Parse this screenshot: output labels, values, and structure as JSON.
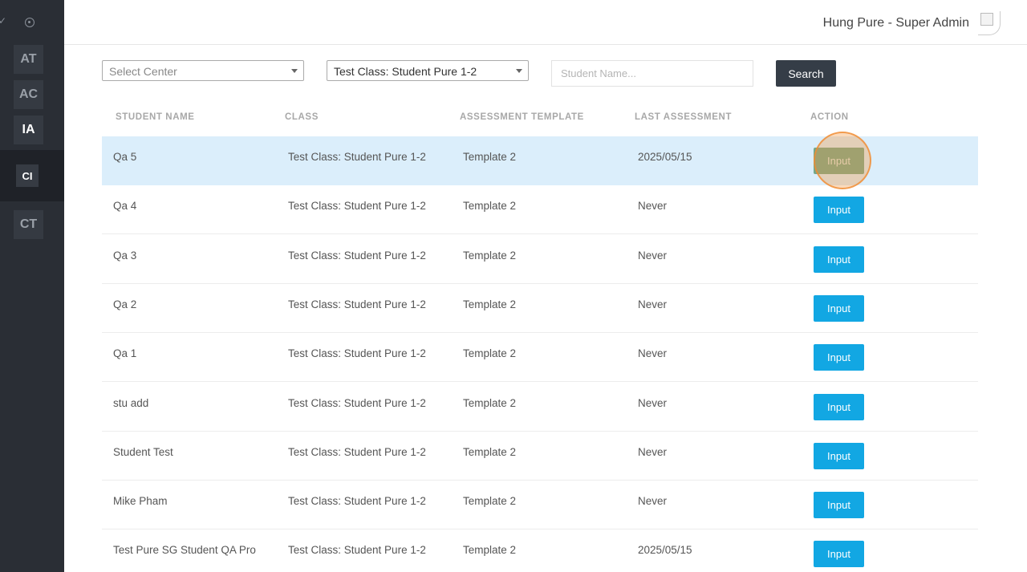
{
  "sidebar": {
    "items": [
      {
        "label": "AT"
      },
      {
        "label": "AC"
      },
      {
        "label": "IA"
      },
      {
        "label": "CI"
      },
      {
        "label": "CT"
      }
    ]
  },
  "header": {
    "user": "Hung Pure - Super Admin"
  },
  "filters": {
    "center_placeholder": "Select Center",
    "class_value": "Test Class: Student Pure 1-2",
    "student_placeholder": "Student Name...",
    "search_label": "Search"
  },
  "table": {
    "headers": [
      "STUDENT NAME",
      "CLASS",
      "ASSESSMENT TEMPLATE",
      "LAST ASSESSMENT",
      "ACTION"
    ],
    "rows": [
      {
        "name": "Qa 5",
        "class": "Test Class: Student Pure 1-2",
        "template": "Template 2",
        "last": "2025/05/15",
        "action": "Input"
      },
      {
        "name": "Qa 4",
        "class": "Test Class: Student Pure 1-2",
        "template": "Template 2",
        "last": "Never",
        "action": "Input"
      },
      {
        "name": "Qa 3",
        "class": "Test Class: Student Pure 1-2",
        "template": "Template 2",
        "last": "Never",
        "action": "Input"
      },
      {
        "name": "Qa 2",
        "class": "Test Class: Student Pure 1-2",
        "template": "Template 2",
        "last": "Never",
        "action": "Input"
      },
      {
        "name": "Qa 1",
        "class": "Test Class: Student Pure 1-2",
        "template": "Template 2",
        "last": "Never",
        "action": "Input"
      },
      {
        "name": "stu add",
        "class": "Test Class: Student Pure 1-2",
        "template": "Template 2",
        "last": "Never",
        "action": "Input"
      },
      {
        "name": "Student Test",
        "class": "Test Class: Student Pure 1-2",
        "template": "Template 2",
        "last": "Never",
        "action": "Input"
      },
      {
        "name": "Mike Pham",
        "class": "Test Class: Student Pure 1-2",
        "template": "Template 2",
        "last": "Never",
        "action": "Input"
      },
      {
        "name": "Test Pure SG Student QA Pro",
        "class": "Test Class: Student Pure 1-2",
        "template": "Template 2",
        "last": "2025/05/15",
        "action": "Input"
      }
    ]
  }
}
